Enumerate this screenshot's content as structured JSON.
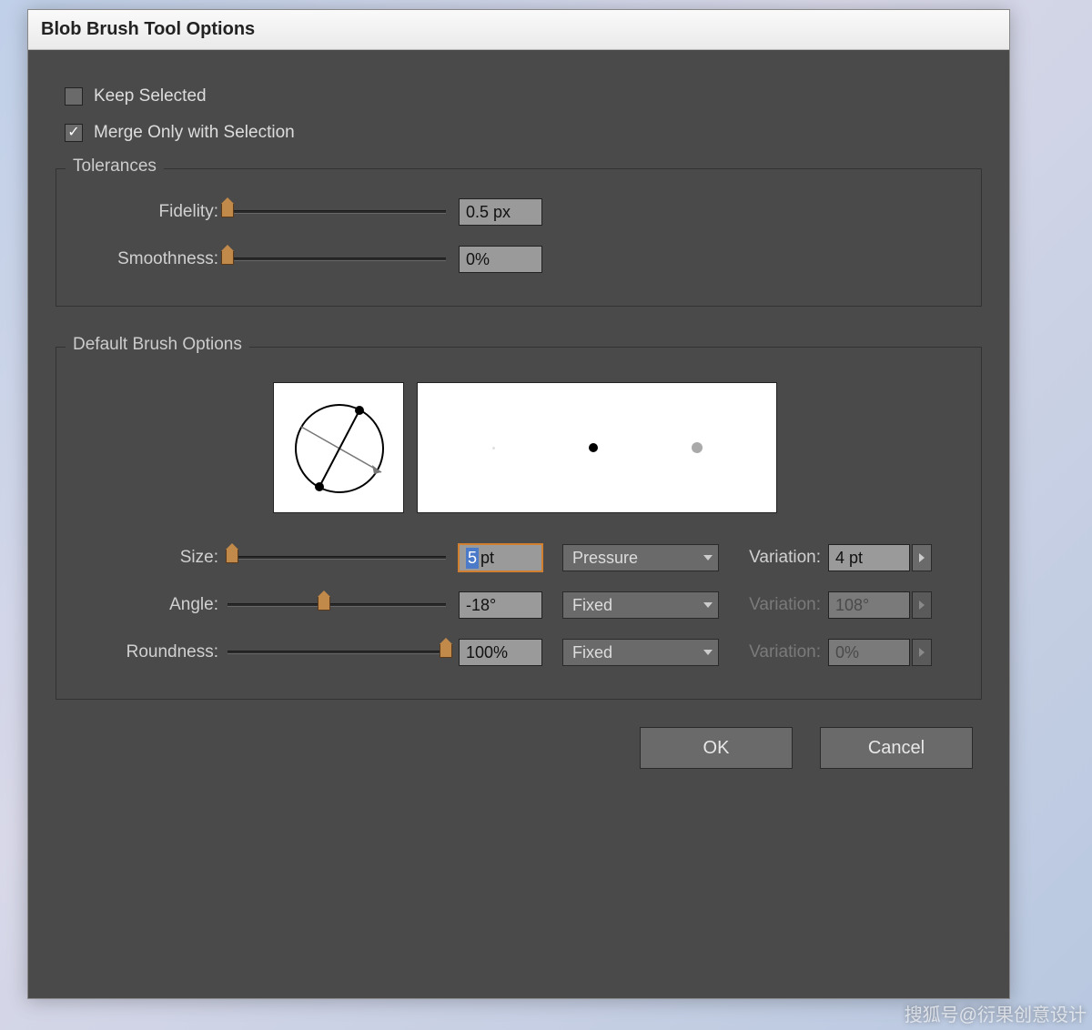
{
  "window": {
    "title": "Blob Brush Tool Options"
  },
  "options": {
    "keep_selected": {
      "label": "Keep Selected",
      "checked": false
    },
    "merge_only": {
      "label": "Merge Only with Selection",
      "checked": true
    }
  },
  "tolerances": {
    "legend": "Tolerances",
    "fidelity": {
      "label": "Fidelity:",
      "value": "0.5 px",
      "slider_pct": 0
    },
    "smoothness": {
      "label": "Smoothness:",
      "value": "0%",
      "slider_pct": 0
    }
  },
  "brush": {
    "legend": "Default Brush Options",
    "size": {
      "label": "Size:",
      "value_num": "5",
      "value_unit": " pt",
      "slider_pct": 2,
      "mode": "Pressure",
      "variation_label": "Variation:",
      "variation_value": "4 pt",
      "variation_enabled": true
    },
    "angle": {
      "label": "Angle:",
      "value": "-18°",
      "slider_pct": 44,
      "mode": "Fixed",
      "variation_label": "Variation:",
      "variation_value": "108°",
      "variation_enabled": false
    },
    "roundness": {
      "label": "Roundness:",
      "value": "100%",
      "slider_pct": 100,
      "mode": "Fixed",
      "variation_label": "Variation:",
      "variation_value": "0%",
      "variation_enabled": false
    }
  },
  "buttons": {
    "ok": "OK",
    "cancel": "Cancel"
  },
  "watermark": "搜狐号@衍果创意设计"
}
